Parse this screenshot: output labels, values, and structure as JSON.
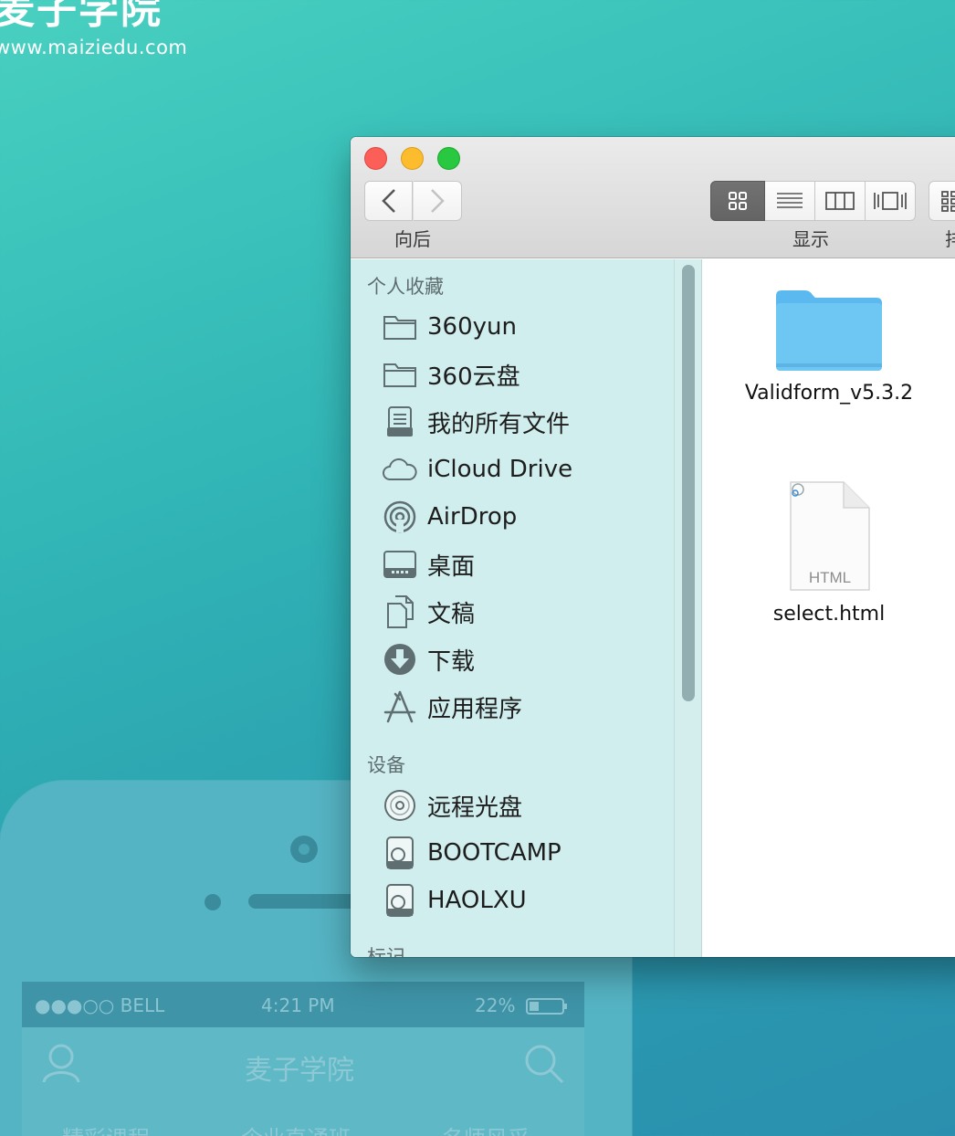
{
  "background": {
    "logo_cn": "麦子学院",
    "logo_url": "www.maiziedu.com",
    "phone": {
      "status_signal": "●●●○○ BELL",
      "status_time": "4:21 PM",
      "status_battery": "22%",
      "title": "麦子学院",
      "tabs": [
        "精彩课程",
        "企业直通班",
        "名师风采"
      ]
    }
  },
  "finder": {
    "toolbar": {
      "back_forward_label": "向后",
      "view_label": "显示",
      "arrange_label_partial": "排"
    },
    "sidebar": {
      "favorites_header": "个人收藏",
      "favorites": [
        {
          "label": "360yun",
          "icon": "folder-icon"
        },
        {
          "label": "360云盘",
          "icon": "folder-icon"
        },
        {
          "label": "我的所有文件",
          "icon": "all-files-icon"
        },
        {
          "label": "iCloud Drive",
          "icon": "cloud-icon"
        },
        {
          "label": "AirDrop",
          "icon": "airdrop-icon"
        },
        {
          "label": "桌面",
          "icon": "desktop-icon"
        },
        {
          "label": "文稿",
          "icon": "documents-icon"
        },
        {
          "label": "下载",
          "icon": "download-icon"
        },
        {
          "label": "应用程序",
          "icon": "applications-icon"
        }
      ],
      "devices_header": "设备",
      "devices": [
        {
          "label": "远程光盘",
          "icon": "disc-icon"
        },
        {
          "label": "BOOTCAMP",
          "icon": "hard-drive-icon"
        },
        {
          "label": "HAOLXU",
          "icon": "hard-drive-icon",
          "ejectable": true
        }
      ],
      "tags_header_partial": "标记"
    },
    "files": [
      {
        "name": "Validform_v5.3.2",
        "type": "folder",
        "icon": "folder-icon"
      },
      {
        "name": "select.html",
        "type": "html",
        "icon": "html-file-icon",
        "badge": "HTML"
      }
    ],
    "colors": {
      "sidebar_bg": "#d1eeee",
      "folder_blue": "#6ec6f3",
      "close": "#fc5f57",
      "minimize": "#fdbc2e",
      "zoom": "#28c840"
    }
  }
}
